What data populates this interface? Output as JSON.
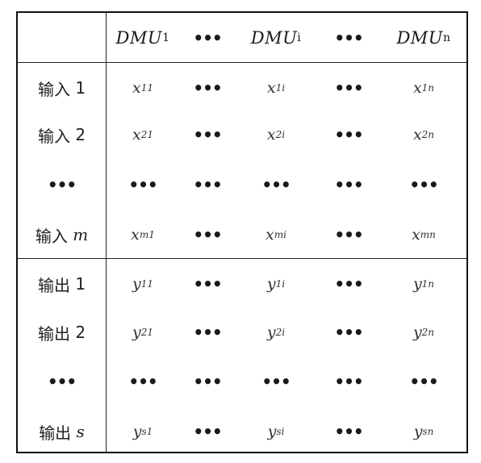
{
  "header": {
    "dmu_base": "DMU",
    "cols": [
      {
        "sub": "1"
      },
      {
        "dots": "•••"
      },
      {
        "sub": "i"
      },
      {
        "dots": "•••"
      },
      {
        "sub": "n"
      }
    ]
  },
  "rows": [
    {
      "label": "输入",
      "suffix": "1",
      "cells": [
        {
          "base": "x",
          "sub": "11"
        },
        {
          "dots": "•••"
        },
        {
          "base": "x",
          "sub": "1i"
        },
        {
          "dots": "•••"
        },
        {
          "base": "x",
          "sub": "1n"
        }
      ]
    },
    {
      "label": "输入",
      "suffix": "2",
      "cells": [
        {
          "base": "x",
          "sub": "21"
        },
        {
          "dots": "•••"
        },
        {
          "base": "x",
          "sub": "2i"
        },
        {
          "dots": "•••"
        },
        {
          "base": "x",
          "sub": "2n"
        }
      ]
    },
    {
      "label_dots": "•••",
      "cells": [
        {
          "dots": "•••"
        },
        {
          "dots": "•••"
        },
        {
          "dots": "•••"
        },
        {
          "dots": "•••"
        },
        {
          "dots": "•••"
        }
      ]
    },
    {
      "label": "输入",
      "suffix_var": "m",
      "cells": [
        {
          "base": "x",
          "sub": "m1"
        },
        {
          "dots": "•••"
        },
        {
          "base": "x",
          "sub": "mi"
        },
        {
          "dots": "•••"
        },
        {
          "base": "x",
          "sub": "mn"
        }
      ]
    },
    {
      "label": "输出",
      "suffix": "1",
      "cells": [
        {
          "base": "y",
          "sub": "11"
        },
        {
          "dots": "•••"
        },
        {
          "base": "y",
          "sub": "1i"
        },
        {
          "dots": "•••"
        },
        {
          "base": "y",
          "sub": "1n"
        }
      ]
    },
    {
      "label": "输出",
      "suffix": "2",
      "cells": [
        {
          "base": "y",
          "sub": "21"
        },
        {
          "dots": "•••"
        },
        {
          "base": "y",
          "sub": "2i"
        },
        {
          "dots": "•••"
        },
        {
          "base": "y",
          "sub": "2n"
        }
      ]
    },
    {
      "label_dots": "•••",
      "cells": [
        {
          "dots": "•••"
        },
        {
          "dots": "•••"
        },
        {
          "dots": "•••"
        },
        {
          "dots": "•••"
        },
        {
          "dots": "•••"
        }
      ]
    },
    {
      "label": "输出",
      "suffix_var": "s",
      "cells": [
        {
          "base": "y",
          "sub": "s1"
        },
        {
          "dots": "•••"
        },
        {
          "base": "y",
          "sub": "si"
        },
        {
          "dots": "•••"
        },
        {
          "base": "y",
          "sub": "sn"
        }
      ]
    }
  ]
}
